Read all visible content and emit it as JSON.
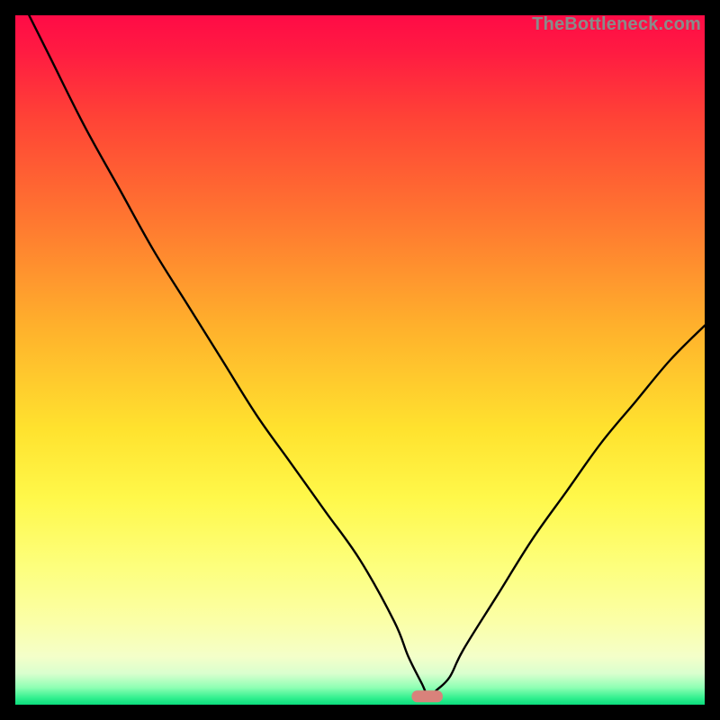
{
  "watermark": "TheBottleneck.com",
  "chart_data": {
    "type": "line",
    "title": "",
    "xlabel": "",
    "ylabel": "",
    "xlim": [
      0,
      100
    ],
    "ylim": [
      0,
      100
    ],
    "grid": false,
    "series": [
      {
        "name": "bottleneck-curve",
        "x": [
          2,
          5,
          10,
          15,
          20,
          25,
          30,
          35,
          40,
          45,
          50,
          55,
          57,
          59,
          60,
          61,
          63,
          65,
          70,
          75,
          80,
          85,
          90,
          95,
          100
        ],
        "values": [
          100,
          94,
          84,
          75,
          66,
          58,
          50,
          42,
          35,
          28,
          21,
          12,
          7,
          3,
          1,
          2,
          4,
          8,
          16,
          24,
          31,
          38,
          44,
          50,
          55
        ]
      }
    ],
    "marker": {
      "name": "optimal-point",
      "x_range": [
        57.5,
        62
      ],
      "y": 1.2,
      "color": "#d9827b"
    },
    "gradient_stops": [
      {
        "offset": 0.0,
        "color": "#ff0b46"
      },
      {
        "offset": 0.05,
        "color": "#ff1a42"
      },
      {
        "offset": 0.15,
        "color": "#ff4336"
      },
      {
        "offset": 0.3,
        "color": "#ff7830"
      },
      {
        "offset": 0.45,
        "color": "#ffb02c"
      },
      {
        "offset": 0.6,
        "color": "#ffe22e"
      },
      {
        "offset": 0.7,
        "color": "#fff84a"
      },
      {
        "offset": 0.8,
        "color": "#fdff7d"
      },
      {
        "offset": 0.88,
        "color": "#fbffa8"
      },
      {
        "offset": 0.93,
        "color": "#f4ffc9"
      },
      {
        "offset": 0.955,
        "color": "#d9ffce"
      },
      {
        "offset": 0.975,
        "color": "#8fffb4"
      },
      {
        "offset": 0.99,
        "color": "#33f08f"
      },
      {
        "offset": 1.0,
        "color": "#0bdc7d"
      }
    ]
  }
}
